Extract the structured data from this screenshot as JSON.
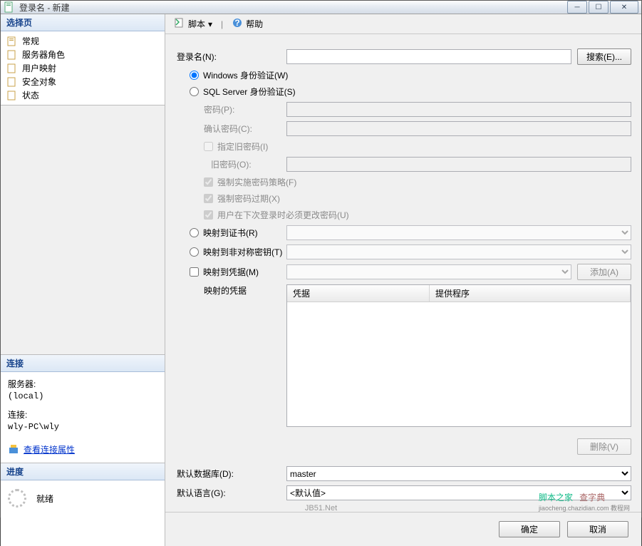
{
  "window": {
    "title": "登录名 - 新建"
  },
  "sidebar": {
    "select_header": "选择页",
    "items": [
      {
        "label": "常规"
      },
      {
        "label": "服务器角色"
      },
      {
        "label": "用户映射"
      },
      {
        "label": "安全对象"
      },
      {
        "label": "状态"
      }
    ],
    "conn_header": "连接",
    "server_label": "服务器:",
    "server_value": "(local)",
    "conn_label": "连接:",
    "conn_value": "wly-PC\\wly",
    "conn_props_link": "查看连接属性",
    "progress_header": "进度",
    "progress_status": "就绪"
  },
  "toolbar": {
    "script": "脚本",
    "help": "帮助"
  },
  "form": {
    "login_label": "登录名(N):",
    "login_value": "",
    "search_btn": "搜索(E)...",
    "auth_windows": "Windows 身份验证(W)",
    "auth_sql": "SQL Server 身份验证(S)",
    "pwd_label": "密码(P):",
    "pwd_confirm_label": "确认密码(C):",
    "pwd_old_specify": "指定旧密码(I)",
    "pwd_old_label": "旧密码(O):",
    "pwd_policy": "强制实施密码策略(F)",
    "pwd_expire": "强制密码过期(X)",
    "pwd_mustchange": "用户在下次登录时必须更改密码(U)",
    "map_cert": "映射到证书(R)",
    "map_asym": "映射到非对称密钥(T)",
    "map_cred": "映射到凭据(M)",
    "add_btn": "添加(A)",
    "mapped_creds_label": "映射的凭据",
    "cred_col1": "凭据",
    "cred_col2": "提供程序",
    "delete_btn": "删除(V)",
    "default_db_label": "默认数据库(D):",
    "default_db_value": "master",
    "default_lang_label": "默认语言(G):",
    "default_lang_value": "<默认值>"
  },
  "buttons": {
    "ok": "确定",
    "cancel": "取消"
  },
  "watermark": {
    "site1": "脚本之家",
    "mid": "JB51.Net",
    "site2": "查字典",
    "small": "jiaocheng.chazidian.com 教程网"
  }
}
